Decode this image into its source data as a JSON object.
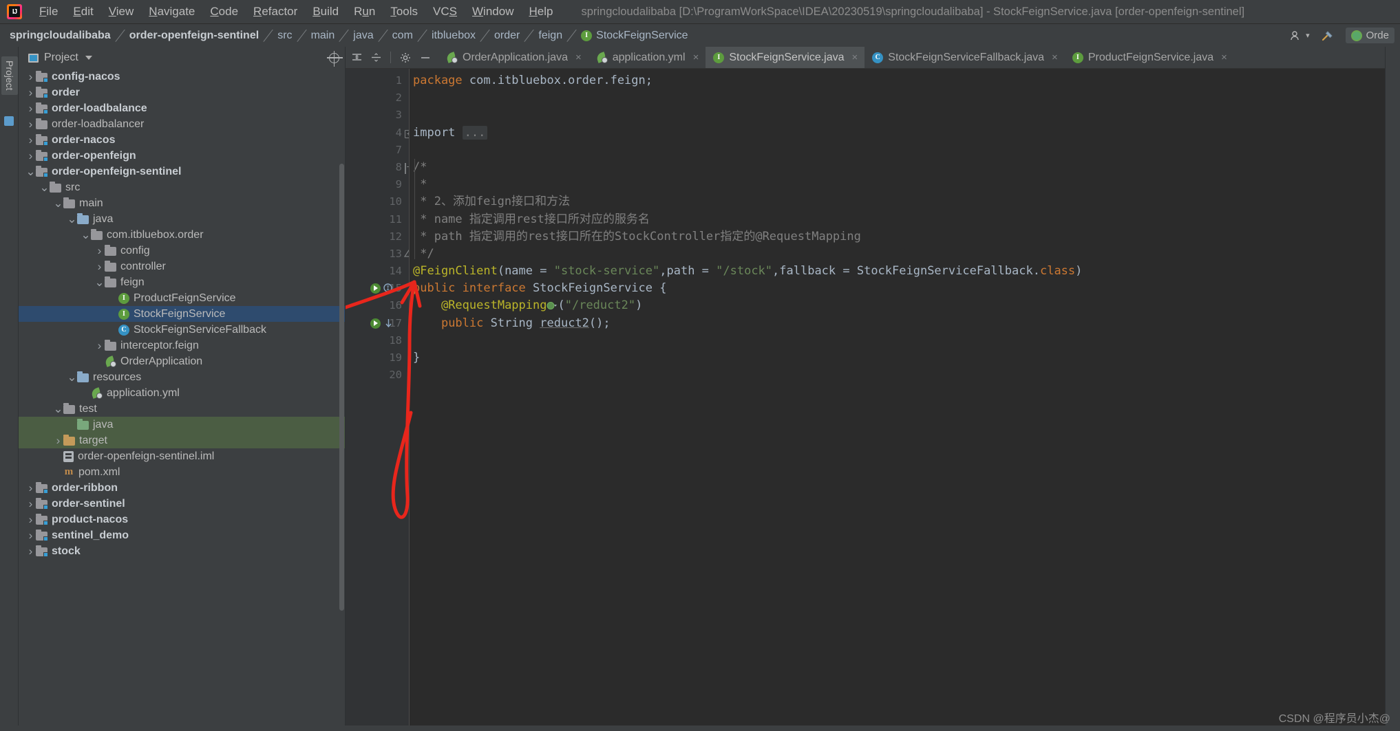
{
  "titlebar": {
    "logo": "intellij-idea-logo",
    "menus": [
      {
        "label": "File",
        "mnemonic": "F"
      },
      {
        "label": "Edit",
        "mnemonic": "E"
      },
      {
        "label": "View",
        "mnemonic": "V"
      },
      {
        "label": "Navigate",
        "mnemonic": "N"
      },
      {
        "label": "Code",
        "mnemonic": "C"
      },
      {
        "label": "Refactor",
        "mnemonic": "R"
      },
      {
        "label": "Build",
        "mnemonic": "B"
      },
      {
        "label": "Run",
        "mnemonic": "u"
      },
      {
        "label": "Tools",
        "mnemonic": "T"
      },
      {
        "label": "VCS",
        "mnemonic": "S"
      },
      {
        "label": "Window",
        "mnemonic": "W"
      },
      {
        "label": "Help",
        "mnemonic": "H"
      }
    ],
    "window_title": "springcloudalibaba [D:\\ProgramWorkSpace\\IDEA\\20230519\\springcloudalibaba] - StockFeignService.java [order-openfeign-sentinel]"
  },
  "navbar": {
    "breadcrumbs": [
      {
        "label": "springcloudalibaba",
        "bold": true
      },
      {
        "label": "order-openfeign-sentinel",
        "bold": true
      },
      {
        "label": "src",
        "bold": false
      },
      {
        "label": "main",
        "bold": false
      },
      {
        "label": "java",
        "bold": false
      },
      {
        "label": "com",
        "bold": false
      },
      {
        "label": "itbluebox",
        "bold": false
      },
      {
        "label": "order",
        "bold": false
      },
      {
        "label": "feign",
        "bold": false
      },
      {
        "label": "StockFeignService",
        "bold": false,
        "icon": "interface-icon"
      }
    ],
    "right_icons": [
      "user-settings-icon",
      "hammer-build-icon"
    ],
    "run_config": "Orde"
  },
  "left_rail": {
    "tab_label": "Project",
    "structure_icon": "structure-icon"
  },
  "project_panel": {
    "title": "Project",
    "dropdown_icon": "chevron-down-icon",
    "locate_icon": "crosshair-icon",
    "tree": [
      {
        "label": "config-nacos",
        "depth": 1,
        "arrow": "right",
        "icon": "module-folder-icon",
        "bold": true
      },
      {
        "label": "order",
        "depth": 1,
        "arrow": "right",
        "icon": "module-folder-icon",
        "bold": true
      },
      {
        "label": "order-loadbalance",
        "depth": 1,
        "arrow": "right",
        "icon": "module-folder-icon",
        "bold": true
      },
      {
        "label": "order-loadbalancer",
        "depth": 1,
        "arrow": "right",
        "icon": "folder-icon",
        "bold": false
      },
      {
        "label": "order-nacos",
        "depth": 1,
        "arrow": "right",
        "icon": "module-folder-icon",
        "bold": true
      },
      {
        "label": "order-openfeign",
        "depth": 1,
        "arrow": "right",
        "icon": "module-folder-icon",
        "bold": true
      },
      {
        "label": "order-openfeign-sentinel",
        "depth": 1,
        "arrow": "down",
        "icon": "module-folder-icon",
        "bold": true
      },
      {
        "label": "src",
        "depth": 2,
        "arrow": "down",
        "icon": "folder-icon",
        "bold": false
      },
      {
        "label": "main",
        "depth": 3,
        "arrow": "down",
        "icon": "folder-icon",
        "bold": false
      },
      {
        "label": "java",
        "depth": 4,
        "arrow": "down",
        "icon": "source-folder-icon",
        "bold": false
      },
      {
        "label": "com.itbluebox.order",
        "depth": 5,
        "arrow": "down",
        "icon": "package-icon",
        "bold": false
      },
      {
        "label": "config",
        "depth": 6,
        "arrow": "right",
        "icon": "package-icon",
        "bold": false
      },
      {
        "label": "controller",
        "depth": 6,
        "arrow": "right",
        "icon": "package-icon",
        "bold": false
      },
      {
        "label": "feign",
        "depth": 6,
        "arrow": "down",
        "icon": "package-icon",
        "bold": false
      },
      {
        "label": "ProductFeignService",
        "depth": 7,
        "arrow": "none",
        "icon": "interface-icon",
        "bold": false
      },
      {
        "label": "StockFeignService",
        "depth": 7,
        "arrow": "none",
        "icon": "interface-icon",
        "bold": false,
        "selected": true
      },
      {
        "label": "StockFeignServiceFallback",
        "depth": 7,
        "arrow": "none",
        "icon": "class-icon",
        "bold": false
      },
      {
        "label": "interceptor.feign",
        "depth": 6,
        "arrow": "right",
        "icon": "package-icon",
        "bold": false
      },
      {
        "label": "OrderApplication",
        "depth": 6,
        "arrow": "none",
        "icon": "spring-class-icon",
        "bold": false
      },
      {
        "label": "resources",
        "depth": 4,
        "arrow": "down",
        "icon": "resources-folder-icon",
        "bold": false
      },
      {
        "label": "application.yml",
        "depth": 5,
        "arrow": "none",
        "icon": "spring-yml-icon",
        "bold": false
      },
      {
        "label": "test",
        "depth": 3,
        "arrow": "down",
        "icon": "folder-icon",
        "bold": false
      },
      {
        "label": "java",
        "depth": 4,
        "arrow": "none",
        "icon": "test-folder-icon",
        "bold": false,
        "selected_green": true
      },
      {
        "label": "target",
        "depth": 3,
        "arrow": "right",
        "icon": "target-folder-icon",
        "bold": false,
        "selected_green": true
      },
      {
        "label": "order-openfeign-sentinel.iml",
        "depth": 3,
        "arrow": "none",
        "icon": "iml-file-icon",
        "bold": false
      },
      {
        "label": "pom.xml",
        "depth": 3,
        "arrow": "none",
        "icon": "maven-icon",
        "bold": false
      },
      {
        "label": "order-ribbon",
        "depth": 1,
        "arrow": "right",
        "icon": "module-folder-icon",
        "bold": true
      },
      {
        "label": "order-sentinel",
        "depth": 1,
        "arrow": "right",
        "icon": "module-folder-icon",
        "bold": true
      },
      {
        "label": "product-nacos",
        "depth": 1,
        "arrow": "right",
        "icon": "module-folder-icon",
        "bold": true
      },
      {
        "label": "sentinel_demo",
        "depth": 1,
        "arrow": "right",
        "icon": "module-folder-icon",
        "bold": true
      },
      {
        "label": "stock",
        "depth": 1,
        "arrow": "right",
        "icon": "module-folder-icon",
        "bold": true
      }
    ]
  },
  "editor": {
    "toolbar_icons": [
      "expand-all-icon",
      "collapse-all-icon",
      "settings-gear-icon",
      "hide-icon"
    ],
    "tabs": [
      {
        "label": "OrderApplication.java",
        "icon": "spring-class-icon",
        "active": false,
        "close": "×"
      },
      {
        "label": "application.yml",
        "icon": "spring-yml-icon",
        "active": false,
        "close": "×"
      },
      {
        "label": "StockFeignService.java",
        "icon": "interface-icon",
        "active": true,
        "close": "×"
      },
      {
        "label": "StockFeignServiceFallback.java",
        "icon": "class-icon",
        "active": false,
        "close": "×"
      },
      {
        "label": "ProductFeignService.java",
        "icon": "interface-icon",
        "active": false,
        "close": "×"
      }
    ],
    "line_numbers": [
      "1",
      "2",
      "3",
      "4",
      "7",
      "8",
      "9",
      "10",
      "11",
      "12",
      "13",
      "14",
      "15",
      "16",
      "17",
      "18",
      "19",
      "20"
    ],
    "code_lines": [
      {
        "n": "1",
        "segments": [
          {
            "t": "package ",
            "c": "k"
          },
          {
            "t": "com.itbluebox.order.feign;",
            "c": "ty"
          }
        ]
      },
      {
        "n": "2",
        "segments": []
      },
      {
        "n": "3",
        "segments": []
      },
      {
        "n": "4",
        "segments": [
          {
            "t": "import ",
            "c": "ty"
          },
          {
            "t": "...",
            "c": "fold"
          }
        ]
      },
      {
        "n": "7",
        "segments": []
      },
      {
        "n": "8",
        "segments": [
          {
            "t": "/*",
            "c": "cm"
          }
        ]
      },
      {
        "n": "9",
        "segments": [
          {
            "t": " *",
            "c": "cm"
          }
        ]
      },
      {
        "n": "10",
        "segments": [
          {
            "t": " * 2、添加feign接口和方法",
            "c": "cm"
          }
        ]
      },
      {
        "n": "11",
        "segments": [
          {
            "t": " * name 指定调用rest接口所对应的服务名",
            "c": "cm"
          }
        ]
      },
      {
        "n": "12",
        "segments": [
          {
            "t": " * path 指定调用的rest接口所在的StockController指定的@RequestMapping",
            "c": "cm"
          }
        ]
      },
      {
        "n": "13",
        "segments": [
          {
            "t": " */",
            "c": "cm"
          }
        ]
      },
      {
        "n": "14",
        "segments": [
          {
            "t": "@FeignClient",
            "c": "an"
          },
          {
            "t": "(name = ",
            "c": "ty"
          },
          {
            "t": "\"stock-service\"",
            "c": "s"
          },
          {
            "t": ",path = ",
            "c": "ty"
          },
          {
            "t": "\"/stock\"",
            "c": "s"
          },
          {
            "t": ",fallback = StockFeignServiceFallback.",
            "c": "ty"
          },
          {
            "t": "class",
            "c": "k"
          },
          {
            "t": ")",
            "c": "ty"
          }
        ]
      },
      {
        "n": "15",
        "segments": [
          {
            "t": "public ",
            "c": "k"
          },
          {
            "t": "interface ",
            "c": "k"
          },
          {
            "t": "StockFeignService {",
            "c": "ty"
          }
        ]
      },
      {
        "n": "16",
        "segments": [
          {
            "t": "    ",
            "c": "ty"
          },
          {
            "t": "@RequestMapping",
            "c": "an"
          },
          {
            "t": "(",
            "c": "ty"
          },
          {
            "t": "\"/reduct2\"",
            "c": "s"
          },
          {
            "t": ")",
            "c": "ty"
          }
        ]
      },
      {
        "n": "17",
        "segments": [
          {
            "t": "    ",
            "c": "ty"
          },
          {
            "t": "public ",
            "c": "k"
          },
          {
            "t": "String ",
            "c": "ty"
          },
          {
            "t": "reduct2",
            "c": "fn"
          },
          {
            "t": "();",
            "c": "ty"
          }
        ]
      },
      {
        "n": "18",
        "segments": []
      },
      {
        "n": "19",
        "segments": [
          {
            "t": "}",
            "c": "ty"
          }
        ]
      },
      {
        "n": "20",
        "segments": []
      }
    ],
    "gutter_icons": [
      {
        "line": 4,
        "icon": "fold-expand-icon"
      },
      {
        "line": 8,
        "icon": "fold-collapse-icon"
      },
      {
        "line": 13,
        "icon": "fold-collapse-end-icon"
      },
      {
        "line": 15,
        "icon": "spring-bean-icon"
      },
      {
        "line": 15,
        "icon": "implemented-method-icon"
      },
      {
        "line": 17,
        "icon": "spring-mapping-icon"
      },
      {
        "line": 17,
        "icon": "override-down-icon"
      }
    ],
    "inline_icons": [
      {
        "line": 16,
        "icon": "spring-url-mapping-icon"
      }
    ]
  },
  "annotation": {
    "type": "red-arrow",
    "color": "#e8261c",
    "description": "hand-drawn red arrow from StockFeignService tree item to line 13"
  },
  "watermark": "CSDN @程序员小杰@"
}
